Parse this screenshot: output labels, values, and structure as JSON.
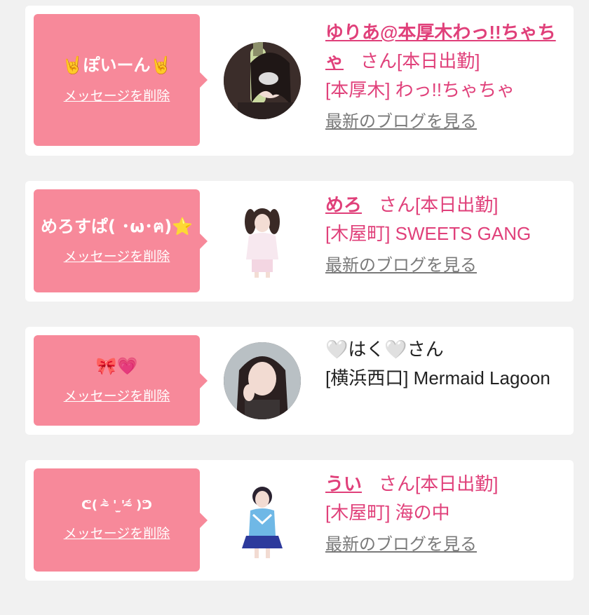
{
  "cards": [
    {
      "message": "🤘ぽいーん🤘",
      "delete_label": "メッセージを削除",
      "name": "ゆりあ@本厚木わっ!!ちゃちゃ",
      "san": "さん",
      "status": "[本日出勤]",
      "shop": "[本厚木] わっ!!ちゃちゃ",
      "blog_label": "最新のブログを見る"
    },
    {
      "message": "めろすぱ( ･ω･ฅ)⭐",
      "delete_label": "メッセージを削除",
      "name": "めろ",
      "san": "さん",
      "status": "[本日出勤]",
      "shop": "[木屋町] SWEETS GANG",
      "blog_label": "最新のブログを見る"
    },
    {
      "message": "🎀💗",
      "delete_label": "メッセージを削除",
      "name": "🤍はく🤍",
      "san": "さん",
      "shop": "[横浜西口] Mermaid Lagoon"
    },
    {
      "message": "ᕦ( ⁼̴̀ ' ̫'⁼̴́ )ᕤ",
      "delete_label": "メッセージを削除",
      "name": "うい",
      "san": "さん",
      "status": "[本日出勤]",
      "shop": "[木屋町] 海の中",
      "blog_label": "最新のブログを見る"
    }
  ]
}
